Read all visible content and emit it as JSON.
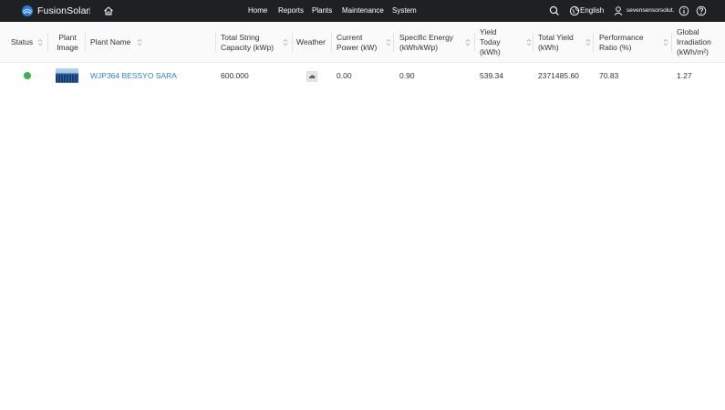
{
  "brand": {
    "name": "FusionSolar"
  },
  "nav": {
    "items": [
      {
        "label": "Home"
      },
      {
        "label": "Reports"
      },
      {
        "label": "Plants"
      },
      {
        "label": "Maintenance"
      },
      {
        "label": "System"
      }
    ]
  },
  "toolbar": {
    "language": "English",
    "user_name": "sevensensorsolut..."
  },
  "icons": {
    "logo": "fusionsolar-logo-icon",
    "home": "home-icon",
    "search": "search-icon",
    "globe": "globe-icon",
    "user": "user-icon",
    "info": "info-icon",
    "help": "help-icon",
    "sort": "sort-icon",
    "weather": "weather-cloudy-icon"
  },
  "colors": {
    "topbar": "#1e2022",
    "link": "#2f7fd1",
    "status_ok": "#3cb44b",
    "header_bg": "#fafafa"
  },
  "table": {
    "headers": {
      "status": "Status",
      "plant_image": [
        "Plant",
        "Image"
      ],
      "plant_name": "Plant Name",
      "total_string_capacity": [
        "Total String",
        "Capacity (kWp)"
      ],
      "weather": "Weather",
      "current_power": [
        "Current",
        "Power (kW)"
      ],
      "specific_energy": [
        "Specific Energy",
        "(kWh/kWp)"
      ],
      "yield_today": [
        "Yield",
        "Today",
        "(kWh)"
      ],
      "total_yield": [
        "Total Yield",
        "(kWh)"
      ],
      "performance_ratio": [
        "Performance",
        "Ratio (%)"
      ],
      "global_irradiation": [
        "Global",
        "Irradiation",
        "(kWh/m²)"
      ]
    },
    "rows": [
      {
        "status": "online",
        "plant_name": "WJP364 BESSYO SARA",
        "total_string_capacity": "600.000",
        "current_power": "0.00",
        "specific_energy": "0.90",
        "yield_today": "539.34",
        "total_yield": "2371485.60",
        "performance_ratio": "70.83",
        "global_irradiation": "1.27"
      }
    ]
  }
}
